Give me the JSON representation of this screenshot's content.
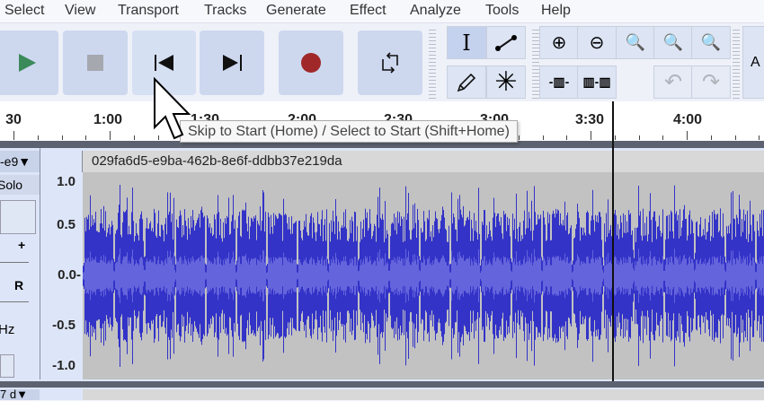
{
  "menu": [
    "Select",
    "View",
    "Transport",
    "Tracks",
    "Generate",
    "Effect",
    "Analyze",
    "Tools",
    "Help"
  ],
  "transport": {
    "buttons": [
      {
        "name": "play-button",
        "icon": "play-icon"
      },
      {
        "name": "stop-button",
        "icon": "stop-icon"
      },
      {
        "name": "skip-to-start-button",
        "icon": "skip-start-icon"
      },
      {
        "name": "skip-to-end-button",
        "icon": "skip-end-icon"
      },
      {
        "name": "record-button",
        "icon": "record-icon"
      },
      {
        "name": "loop-button",
        "icon": "loop-icon"
      }
    ],
    "colors": {
      "play": "#3b8a5a",
      "stop": "#a6a8b0",
      "record": "#a02828",
      "button": "#cdd8ef"
    }
  },
  "tools": [
    "selection-tool",
    "envelope-tool",
    "draw-tool",
    "multi-tool"
  ],
  "edit": [
    "zoom-in",
    "zoom-out",
    "fit-selection",
    "fit-project",
    "zoom-toggle",
    "trim-outside",
    "silence-selection",
    "undo",
    "redo"
  ],
  "cut_label": "A",
  "ruler": {
    "ticks": [
      "30",
      "1:00",
      "1:30",
      "2:00",
      "2:30",
      "3:00",
      "3:30",
      "4:00"
    ]
  },
  "tooltip": "Skip to Start (Home) / Select to Start (Shift+Home)",
  "track": {
    "name_short": "-e9",
    "name": "029fa6d5-e9ba-462b-8e6f-ddbb37e219da",
    "solo": "Solo",
    "pan_plus": "+",
    "pan_r": "R",
    "rate": "Hz",
    "scale": [
      "1.0",
      "0.5",
      "0.0-",
      "-0.5",
      "-1.0"
    ],
    "wave_color": "#3333c8",
    "bg_color": "#c2c2c2"
  },
  "track2": {
    "name_short": "7 d"
  }
}
